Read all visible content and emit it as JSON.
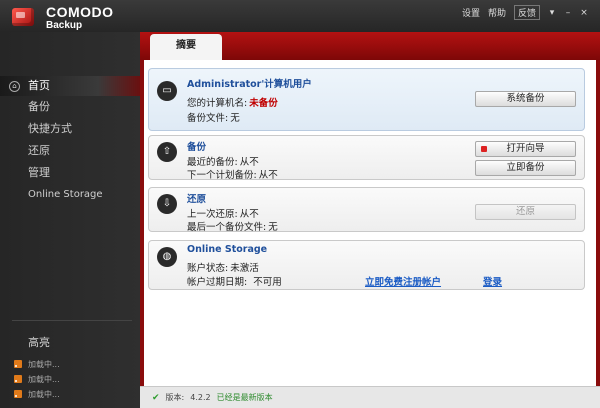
{
  "app": {
    "brand_line1": "COMODO",
    "brand_line2": "Backup"
  },
  "topmenu": {
    "settings": "设置",
    "help": "帮助",
    "feedback": "反馈",
    "minimize": "▾",
    "maximize": "–",
    "close": "×"
  },
  "sidebar": {
    "items": [
      {
        "label": "首页"
      },
      {
        "label": "备份"
      },
      {
        "label": "快捷方式"
      },
      {
        "label": "还原"
      },
      {
        "label": "管理"
      },
      {
        "label": "Online Storage"
      }
    ],
    "news_title": "高亮",
    "news": [
      "加载中...",
      "加载中...",
      "加载中..."
    ]
  },
  "main": {
    "tab_label": "摘要",
    "computer": {
      "title": "Administrator'计算机用户",
      "name_label": "您的计算机名:",
      "name_value": "未备份",
      "files_label": "备份文件:",
      "files_value": "无",
      "button": "系统备份"
    },
    "backup": {
      "title": "备份",
      "last_label": "最近的备份:",
      "last_value": "从不",
      "next_label": "下一个计划备份:",
      "next_value": "从不",
      "wizard_button": "打开向导",
      "now_button": "立即备份"
    },
    "restore": {
      "title": "还原",
      "last_label": "上一次还原:",
      "last_value": "从不",
      "file_label": "最后一个备份文件:",
      "file_value": "无",
      "button": "还原"
    },
    "online": {
      "title": "Online Storage",
      "status_label": "账户状态:",
      "status_value": "未激活",
      "expiry_label": "帐户过期日期:",
      "expiry_value": "不可用",
      "register_link": "立即免费注册帐户",
      "login_link": "登录"
    }
  },
  "status": {
    "version_label": "版本:",
    "version": "4.2.2",
    "message": "已经是最新版本"
  }
}
